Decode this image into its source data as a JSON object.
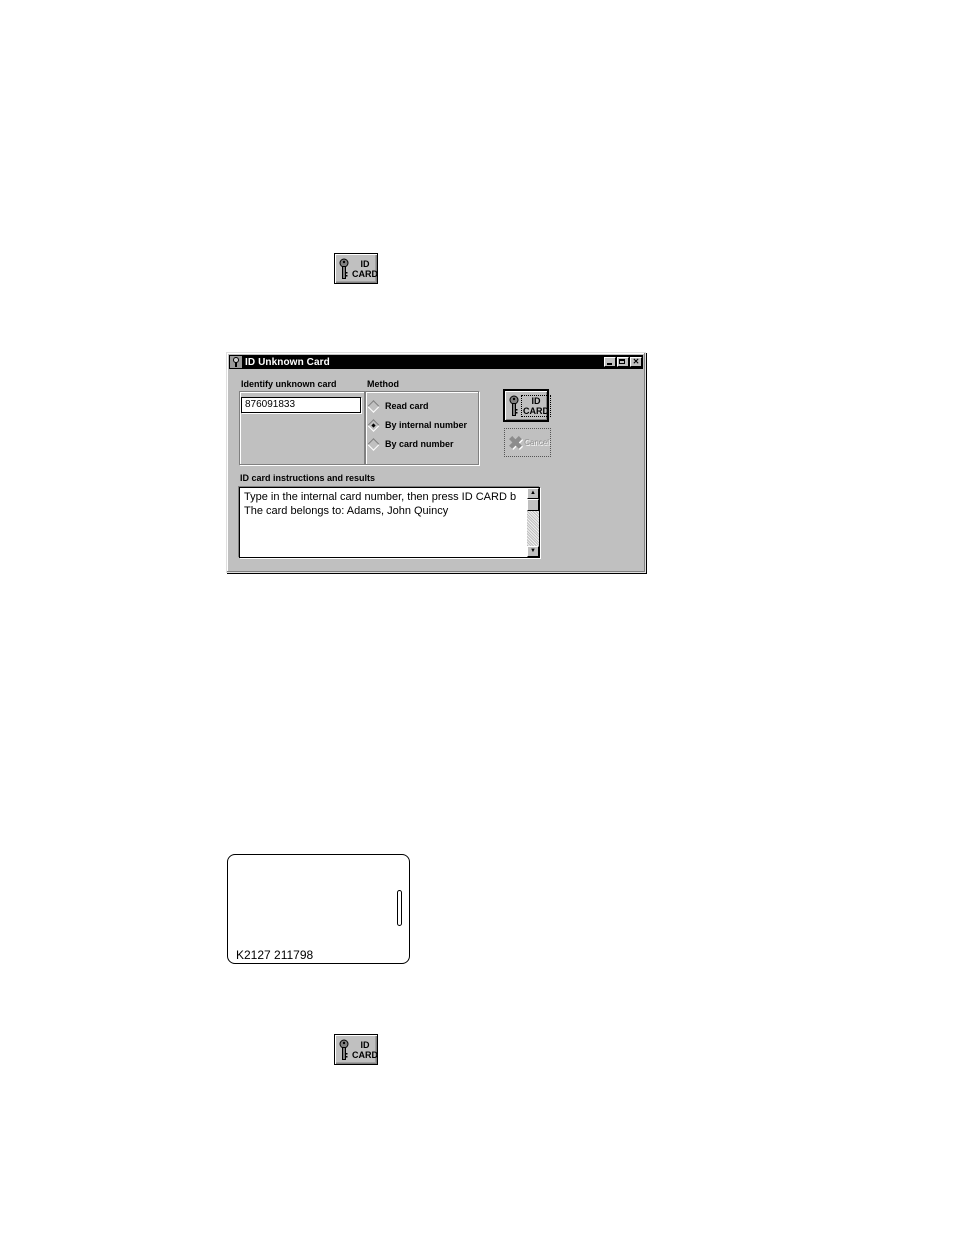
{
  "top_button": {
    "label_line1": "ID",
    "label_line2": "CARD",
    "icon": "key-icon"
  },
  "window": {
    "title": "ID Unknown Card",
    "title_icon": "key-app-icon",
    "controls": {
      "minimize": "minimize",
      "maximize": "maximize",
      "close": "✕"
    },
    "identify_label": "Identify unknown card",
    "identify_value": "876091833",
    "method_label": "Method",
    "methods": [
      {
        "label": "Read card",
        "checked": false
      },
      {
        "label": "By internal number",
        "checked": true
      },
      {
        "label": "By card number",
        "checked": false
      }
    ],
    "id_card_button": {
      "line1": "ID",
      "line2": "CARD"
    },
    "cancel_button": {
      "label": "Cancel",
      "icon": "x-icon",
      "x_glyph": "✖",
      "enabled": false
    },
    "results_label": "ID card instructions and results",
    "results_lines": [
      "Type in the internal card number, then press ID CARD b",
      "The card belongs to:  Adams, John Quincy"
    ],
    "scroll_up": "▲",
    "scroll_down": "▼"
  },
  "card": {
    "number": "K2127  211798"
  },
  "bottom_button": {
    "label_line1": "ID",
    "label_line2": "CARD",
    "icon": "key-icon"
  }
}
